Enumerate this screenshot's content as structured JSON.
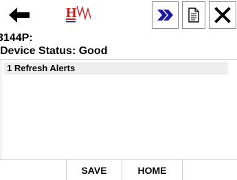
{
  "toolbar": {
    "back_icon": "arrow-left-icon",
    "logo": "hw-logo",
    "next_icon": "double-chevron-right-icon",
    "document_icon": "document-icon",
    "close_icon": "close-icon",
    "accent_color": "#1a1aa6",
    "logo_red": "#d41b1b"
  },
  "header": {
    "device_title": "3144P:",
    "device_status": "Device Status: Good"
  },
  "menu": {
    "items": [
      {
        "label": "1 Refresh Alerts"
      }
    ]
  },
  "footer": {
    "save_label": "SAVE",
    "home_label": "HOME"
  }
}
